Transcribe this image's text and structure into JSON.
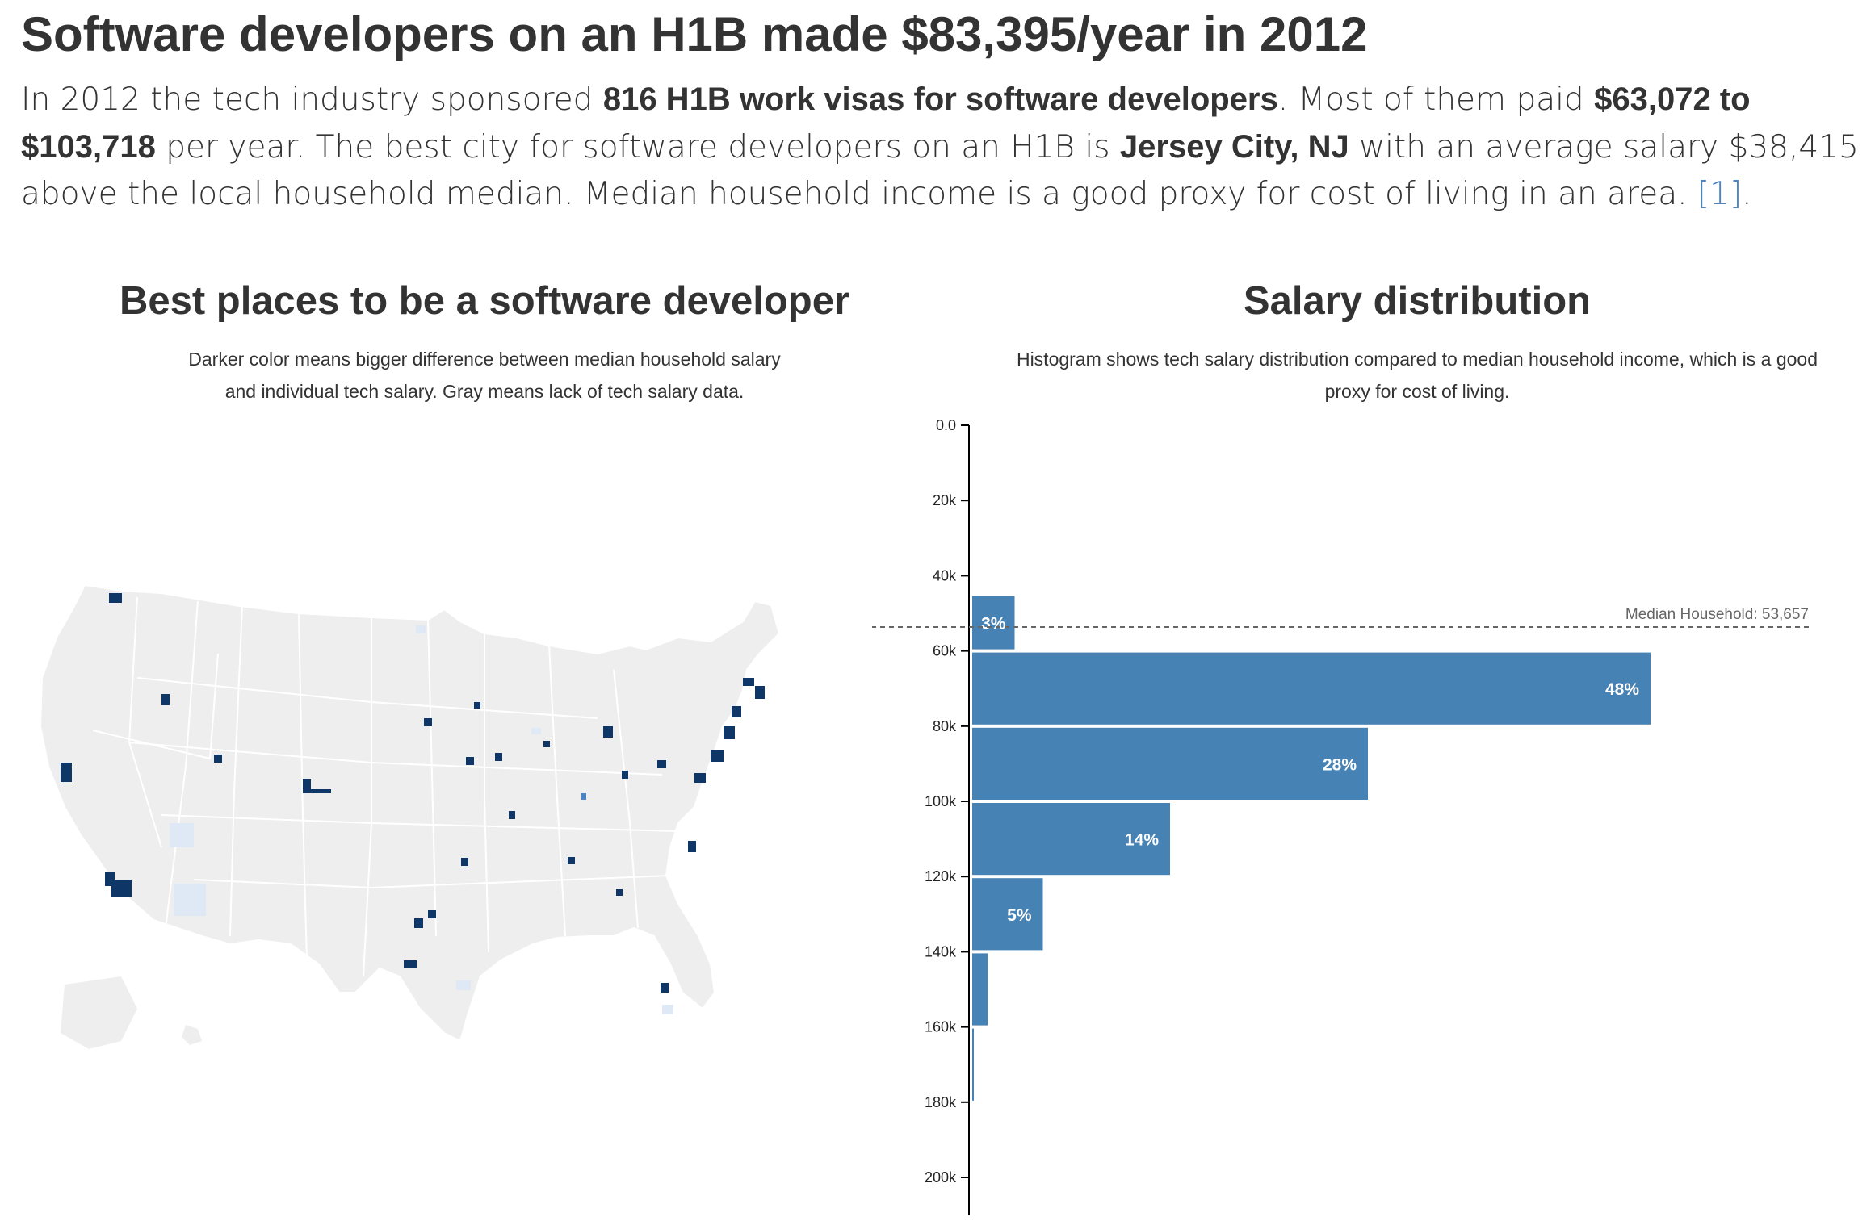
{
  "header": {
    "title": "Software developers on an H1B made $83,395/year in 2012",
    "lede": {
      "p1": "In 2012 the tech industry sponsored ",
      "b1": "816 H1B work visas for software developers",
      "p2": ". Most of them paid ",
      "b2": "$63,072 to $103,718",
      "p3": " per year. The best city for software developers on an H1B is ",
      "b3": "Jersey City, NJ",
      "p4": " with an average salary $38,415 above the local household median. Median household income is a good proxy for cost of living in an area. ",
      "link": "[1]",
      "p5": "."
    }
  },
  "map_panel": {
    "title": "Best places to be a software developer",
    "desc_line1": "Darker color means bigger difference between median household salary",
    "desc_line2": "and individual tech salary. Gray means lack of tech salary data.",
    "colors": {
      "land": "#eeeeef",
      "border": "#ffffff",
      "dark": "#0e3666",
      "mid": "#4a86c6",
      "light": "#dfe9f5"
    }
  },
  "histogram_panel": {
    "title": "Salary distribution",
    "desc_line1": "Histogram shows tech salary distribution compared to median household income, which is a good",
    "desc_line2": "proxy for cost of living.",
    "median_label": "Median Household: 53,657",
    "colors": {
      "bar": "#4682b4",
      "axis": "#000000",
      "median_line": "#666666"
    }
  },
  "chart_data": {
    "type": "bar",
    "orientation": "horizontal",
    "title": "Salary distribution",
    "y_ticks": [
      "0.0",
      "20k",
      "40k",
      "60k",
      "80k",
      "100k",
      "120k",
      "140k",
      "160k",
      "180k",
      "200k"
    ],
    "ylim": [
      0,
      210000
    ],
    "bins": [
      {
        "from": 45000,
        "to": 60000,
        "share": 3,
        "label": "3%"
      },
      {
        "from": 60000,
        "to": 80000,
        "share": 48,
        "label": "48%"
      },
      {
        "from": 80000,
        "to": 100000,
        "share": 28,
        "label": "28%"
      },
      {
        "from": 100000,
        "to": 120000,
        "share": 14,
        "label": "14%"
      },
      {
        "from": 120000,
        "to": 140000,
        "share": 5,
        "label": "5%"
      },
      {
        "from": 140000,
        "to": 160000,
        "share": 1.1,
        "label": ""
      },
      {
        "from": 160000,
        "to": 180000,
        "share": 0.1,
        "label": ""
      }
    ],
    "median_household": 53657,
    "xmax_share": 48
  }
}
